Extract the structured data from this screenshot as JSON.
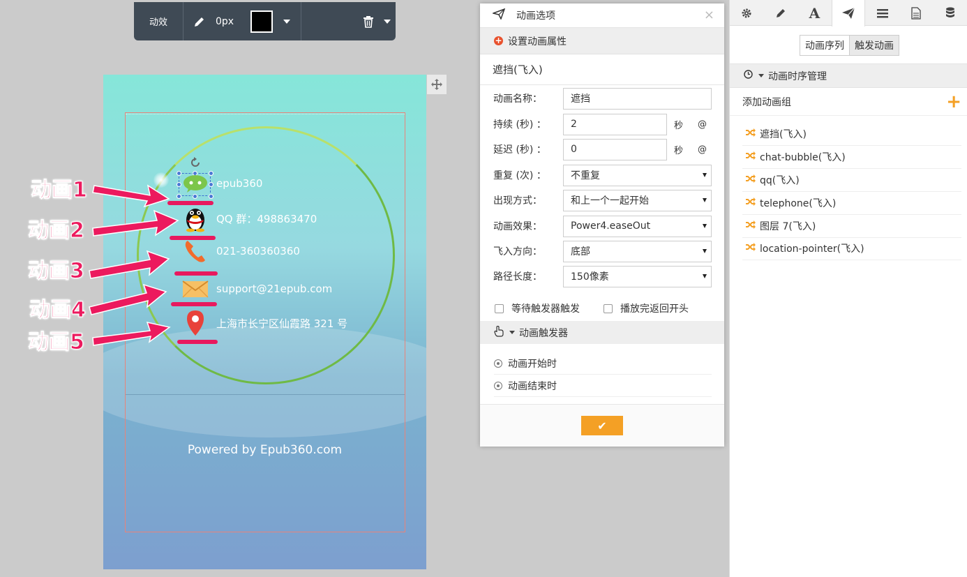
{
  "toolbar": {
    "effect_label": "动效",
    "stroke_width": "0px",
    "swatch_color": "#000000"
  },
  "preview": {
    "contacts": [
      {
        "icon": "wechat-icon",
        "text": "epub360"
      },
      {
        "icon": "qq-penguin-icon",
        "text": "QQ 群：498863470"
      },
      {
        "icon": "phone-icon",
        "text": "021-360360360"
      },
      {
        "icon": "mail-icon",
        "text": "support@21epub.com"
      },
      {
        "icon": "location-pin-icon",
        "text": "上海市长宁区仙霞路 321 号"
      }
    ],
    "powered_by": "Powered by Epub360.com"
  },
  "annotations": [
    "动画1",
    "动画2",
    "动画3",
    "动画4",
    "动画5"
  ],
  "dialog": {
    "title": "动画选项",
    "close": "×",
    "section_title": "设置动画属性",
    "anim_name_display": "遮挡(飞入)",
    "fields": {
      "name_label": "动画名称：",
      "name_value": "遮挡",
      "duration_label": "持续 (秒) ：",
      "duration_value": "2",
      "delay_label": "延迟 (秒) ：",
      "delay_value": "0",
      "unit_sec": "秒",
      "at_symbol": "@",
      "repeat_label": "重复 (次) ：",
      "repeat_value": "不重复",
      "appear_label": "出现方式：",
      "appear_value": "和上一个一起开始",
      "effect_label": "动画效果：",
      "effect_value": "Power4.easeOut",
      "direction_label": "飞入方向：",
      "direction_value": "底部",
      "path_label": "路径长度：",
      "path_value": "150像素"
    },
    "checks": {
      "wait_trigger": "等待触发器触发",
      "return_start": "播放完返回开头"
    },
    "trigger_title": "动画触发器",
    "triggers": [
      "动画开始时",
      "动画结束时"
    ],
    "ok_symbol": "✔"
  },
  "right_panel": {
    "tabs": [
      "settings-tab",
      "pen-tab",
      "text-tab",
      "animation-tab",
      "list-tab",
      "page-tab",
      "database-tab"
    ],
    "seg_on": "动画序列",
    "seg_off": "触发动画",
    "section_title": "动画时序管理",
    "add_group": "添加动画组",
    "add_symbol": "+",
    "items": [
      "遮挡(飞入)",
      "chat-bubble(飞入)",
      "qq(飞入)",
      "telephone(飞入)",
      "图层 7(飞入)",
      "location-pointer(飞入)"
    ]
  },
  "colors": {
    "accent": "#f4a025",
    "annotation": "#e8195e",
    "toolbar_bg": "#3f4a55"
  }
}
